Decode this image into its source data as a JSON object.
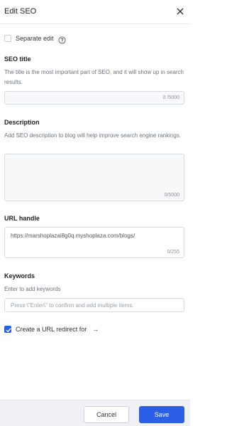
{
  "header": {
    "title": "Edit SEO",
    "close_icon": "close-icon"
  },
  "separate_edit": {
    "label": "Separate edit",
    "checked": false
  },
  "seo_title": {
    "label": "SEO title",
    "description": "The title is the most important part of SEO, and it will show up in search results.",
    "value": "",
    "counter": "0 /5000"
  },
  "description": {
    "label": "Description",
    "help": "Add SEO description to blog will help improve search engine rankings.",
    "value": "",
    "counter": "0/5000"
  },
  "url_handle": {
    "label": "URL handle",
    "value": "https://marshoplazai8g0q.myshoplaza.com/blogs/",
    "counter": "0/255"
  },
  "keywords": {
    "label": "Keywords",
    "description": "Enter to add keywords",
    "placeholder": "Press \\\"Enter\\\" to confirm and add multiple items."
  },
  "redirect": {
    "label": "Create a URL redirect for",
    "arrow": "→",
    "checked": true
  },
  "footer": {
    "cancel_label": "Cancel",
    "save_label": "Save"
  },
  "colors": {
    "accent": "#2b5fe6",
    "border": "#d8dbe0",
    "muted_text": "#6b7280"
  }
}
